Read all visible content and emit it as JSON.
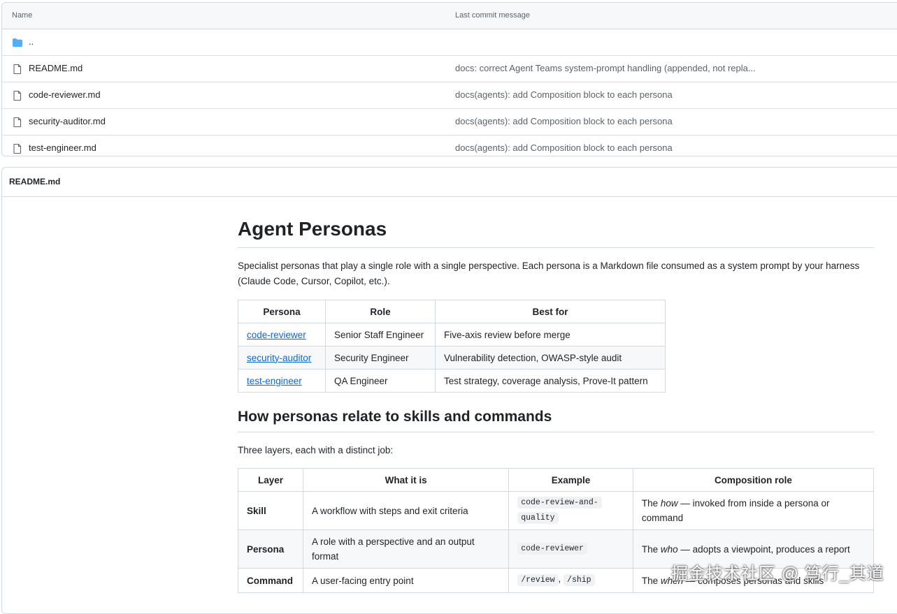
{
  "file_browser": {
    "columns": {
      "name": "Name",
      "message": "Last commit message"
    },
    "parent": "..",
    "files": [
      {
        "name": "README.md",
        "message": "docs: correct Agent Teams system-prompt handling (appended, not repla..."
      },
      {
        "name": "code-reviewer.md",
        "message": "docs(agents): add Composition block to each persona"
      },
      {
        "name": "security-auditor.md",
        "message": "docs(agents): add Composition block to each persona"
      },
      {
        "name": "test-engineer.md",
        "message": "docs(agents): add Composition block to each persona"
      }
    ]
  },
  "readme": {
    "filename": "README.md",
    "title": "Agent Personas",
    "intro": "Specialist personas that play a single role with a single perspective. Each persona is a Markdown file consumed as a system prompt by your harness (Claude Code, Cursor, Copilot, etc.).",
    "personas_table": {
      "headers": [
        "Persona",
        "Role",
        "Best for"
      ],
      "rows": [
        {
          "persona": "code-reviewer",
          "role": "Senior Staff Engineer",
          "best_for": "Five-axis review before merge"
        },
        {
          "persona": "security-auditor",
          "role": "Security Engineer",
          "best_for": "Vulnerability detection, OWASP-style audit"
        },
        {
          "persona": "test-engineer",
          "role": "QA Engineer",
          "best_for": "Test strategy, coverage analysis, Prove-It pattern"
        }
      ]
    },
    "section2_title": "How personas relate to skills and commands",
    "section2_intro": "Three layers, each with a distinct job:",
    "layers_table": {
      "headers": [
        "Layer",
        "What it is",
        "Example",
        "Composition role"
      ],
      "rows": [
        {
          "layer": "Skill",
          "what": "A workflow with steps and exit criteria",
          "example_a": "code-review-and-",
          "example_b": "quality",
          "role_pre": "The ",
          "role_em": "how",
          "role_post": " — invoked from inside a persona or command"
        },
        {
          "layer": "Persona",
          "what": "A role with a perspective and an output format",
          "example_a": "code-reviewer",
          "role_pre": "The ",
          "role_em": "who",
          "role_post": " — adopts a viewpoint, produces a report"
        },
        {
          "layer": "Command",
          "what": "A user-facing entry point",
          "example_a": "/review",
          "example_sep": ", ",
          "example_b": "/ship",
          "role_pre": "The ",
          "role_em": "when",
          "role_post": " — composes personas and skills"
        }
      ]
    }
  },
  "watermark": "掘金技术社区 @ 笃行_其道",
  "colors": {
    "link": "#0969da",
    "folder": "#54aeff",
    "border": "#d1d9e0",
    "muted": "#59636e"
  }
}
